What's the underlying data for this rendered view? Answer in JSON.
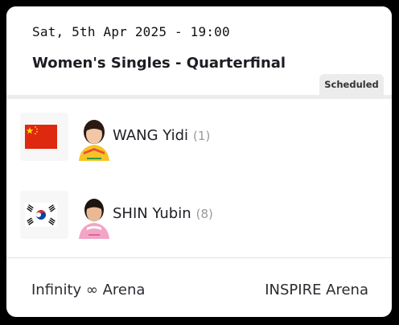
{
  "match": {
    "datetime": "Sat, 5th Apr 2025 - 19:00",
    "round": "Women's Singles - Quarterfinal",
    "status": "Scheduled"
  },
  "players": [
    {
      "name": "WANG Yidi",
      "seed": "(1)",
      "flag": "china-flag-icon"
    },
    {
      "name": "SHIN Yubin",
      "seed": "(8)",
      "flag": "south-korea-flag-icon"
    }
  ],
  "venues": {
    "left": "Infinity ∞ Arena",
    "right": "INSPIRE Arena"
  },
  "colors": {
    "china_red": "#de2910",
    "china_yellow": "#ffde00",
    "korea_red": "#cd2e3a",
    "korea_blue": "#0047a0",
    "badge_bg": "#ececec"
  }
}
